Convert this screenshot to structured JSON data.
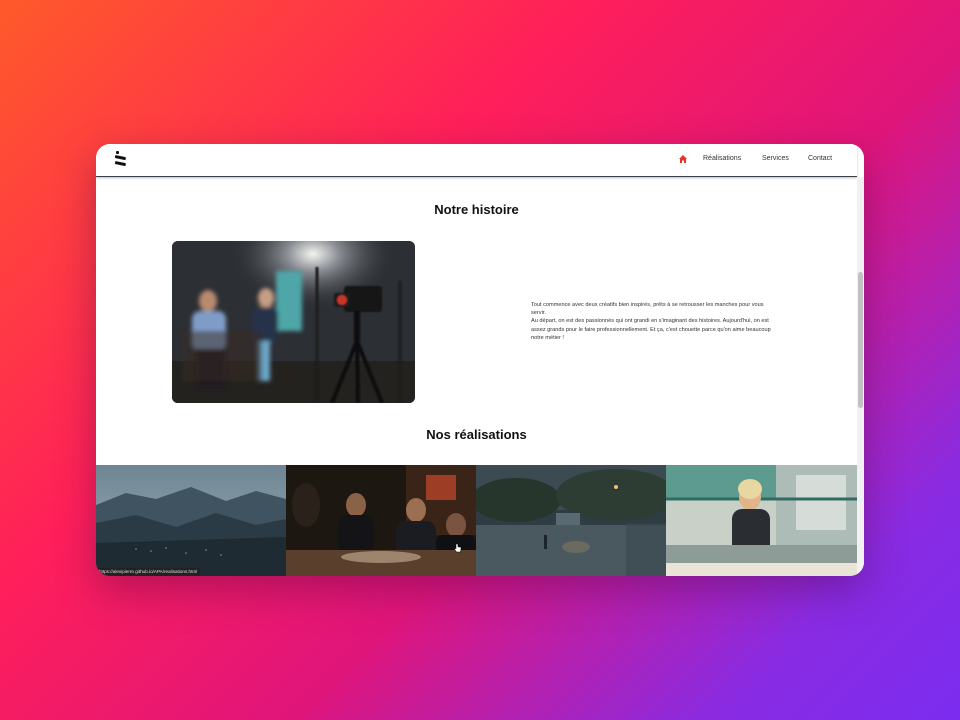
{
  "nav": {
    "home_icon": "home-icon",
    "links": [
      "Réalisations",
      "Services",
      "Contact"
    ],
    "accent": "#e8322c"
  },
  "story": {
    "title": "Notre histoire",
    "paragraph1": "Tout commence avec deux créatifs bien inspirés, prêts à se retrousser les manches pour vous servir.",
    "paragraph2": "Au départ, on est des passionnés qui ont grandi en s'imaginant des histoires. Aujourd'hui, on est assez grands pour le faire professionnellement. Et ça, c'est chouette parce qu'on aime beaucoup notre métier !"
  },
  "works": {
    "title": "Nos réalisations",
    "tiles": [
      "mountain-valley",
      "dinner-scene",
      "night-park",
      "woman-at-window"
    ]
  },
  "status_bar": {
    "url": "https://alexipierre.github.io/APA/realisations.html"
  }
}
